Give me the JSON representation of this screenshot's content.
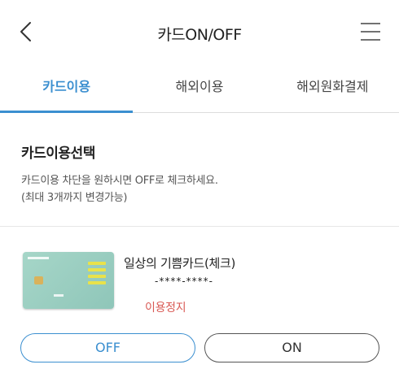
{
  "header": {
    "title": "카드ON/OFF",
    "back_icon": "chevron-left-icon",
    "menu_icon": "hamburger-menu-icon"
  },
  "tabs": [
    {
      "label": "카드이용",
      "active": true
    },
    {
      "label": "해외이용",
      "active": false
    },
    {
      "label": "해외원화결제",
      "active": false
    }
  ],
  "section": {
    "title": "카드이용선택",
    "desc_line1": "카드이용 차단을 원하시면 OFF로 체크하세요.",
    "desc_line2": "(최대 3개까지 변경가능)"
  },
  "card": {
    "name": "일상의 기쁨카드(체크)",
    "number": "-****-****-",
    "status": "이용정지",
    "status_color": "#d95a55",
    "card_color": "#9ccfc2"
  },
  "buttons": {
    "off_label": "OFF",
    "on_label": "ON",
    "selected": "OFF"
  },
  "colors": {
    "accent": "#3b8fd0"
  }
}
